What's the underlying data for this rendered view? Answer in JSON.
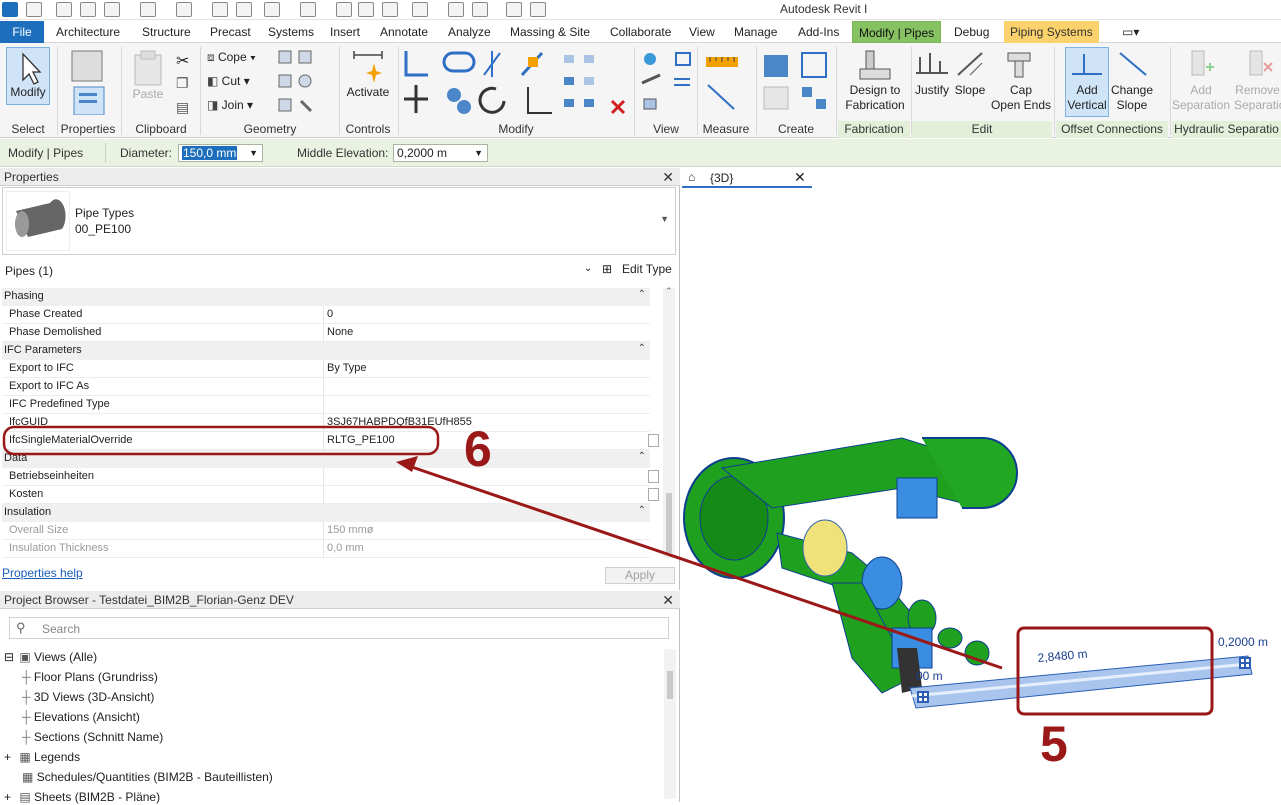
{
  "app_title": "Autodesk Revit I",
  "tabs": [
    "File",
    "Architecture",
    "Structure",
    "Precast",
    "Systems",
    "Insert",
    "Annotate",
    "Analyze",
    "Massing & Site",
    "Collaborate",
    "View",
    "Manage",
    "Add-Ins",
    "Modify | Pipes",
    "Debug",
    "Piping Systems"
  ],
  "ribbon": {
    "modify": "Modify",
    "select": "Select",
    "properties": "Properties",
    "clipboard": "Clipboard",
    "paste": "Paste",
    "cope": "Cope",
    "cut": "Cut",
    "join": "Join",
    "geometry": "Geometry",
    "activate": "Activate",
    "controls": "Controls",
    "modify_panel": "Modify",
    "view_panel": "View",
    "measure": "Measure",
    "create": "Create",
    "design_to_fab_1": "Design to",
    "design_to_fab_2": "Fabrication",
    "fabrication": "Fabrication",
    "justify": "Justify",
    "slope": "Slope",
    "cap_1": "Cap",
    "cap_2": "Open Ends",
    "edit": "Edit",
    "add_vertical_1": "Add",
    "add_vertical_2": "Vertical",
    "change_slope_1": "Change",
    "change_slope_2": "Slope",
    "offset_connections": "Offset Connections",
    "add_sep_1": "Add",
    "add_sep_2": "Separation",
    "remove_sep_1": "Remove",
    "remove_sep_2": "Separatio",
    "hydraulic_sep": "Hydraulic Separatio"
  },
  "options_bar": {
    "context": "Modify | Pipes",
    "diameter_label": "Diameter:",
    "diameter_value": "150,0 mm",
    "middle_elev_label": "Middle Elevation:",
    "middle_elev_value": "0,2000 m"
  },
  "properties": {
    "title": "Properties",
    "type_family": "Pipe Types",
    "type_name": "00_PE100",
    "selection": "Pipes (1)",
    "edit_type": "Edit Type",
    "help": "Properties help",
    "apply": "Apply",
    "rows": [
      {
        "cat": "Phasing"
      },
      {
        "k": "Phase Created",
        "v": "0"
      },
      {
        "k": "Phase Demolished",
        "v": "None"
      },
      {
        "cat": "IFC Parameters"
      },
      {
        "k": "Export to IFC",
        "v": "By Type"
      },
      {
        "k": "Export to IFC As",
        "v": ""
      },
      {
        "k": "IFC Predefined Type",
        "v": ""
      },
      {
        "k": "IfcGUID",
        "v": "3SJ67HABPDQfB31EUfH855"
      },
      {
        "k": "IfcSingleMaterialOverride",
        "v": "RLTG_PE100"
      },
      {
        "cat": "Data"
      },
      {
        "k": "Betriebseinheiten",
        "v": ""
      },
      {
        "k": "Kosten",
        "v": ""
      },
      {
        "cat": "Insulation"
      },
      {
        "k": "Overall Size",
        "v": "150 mmø"
      },
      {
        "k": "Insulation Thickness",
        "v": "0,0 mm"
      }
    ]
  },
  "browser": {
    "title": "Project Browser - Testdatei_BIM2B_Florian-Genz DEV",
    "search_placeholder": "Search",
    "items": [
      "Views (Alle)",
      "Floor Plans (Grundriss)",
      "3D Views (3D-Ansicht)",
      "Elevations (Ansicht)",
      "Sections (Schnitt Name)",
      "Legends",
      "Schedules/Quantities (BIM2B - Bauteillisten)",
      "Sheets (BIM2B - Pläne)"
    ]
  },
  "view": {
    "tab_label": "{3D}",
    "dim_length": "2,8480 m",
    "dim_elev_right": "0,2000 m",
    "dim_elev_left": "00 m"
  },
  "annotations": {
    "six": "6",
    "five": "5"
  },
  "colors": {
    "accent_blue": "#1d6fbd",
    "annotation_red": "#9b1818",
    "pipe_green": "#1fa01f",
    "context_tab": "#86c262"
  }
}
